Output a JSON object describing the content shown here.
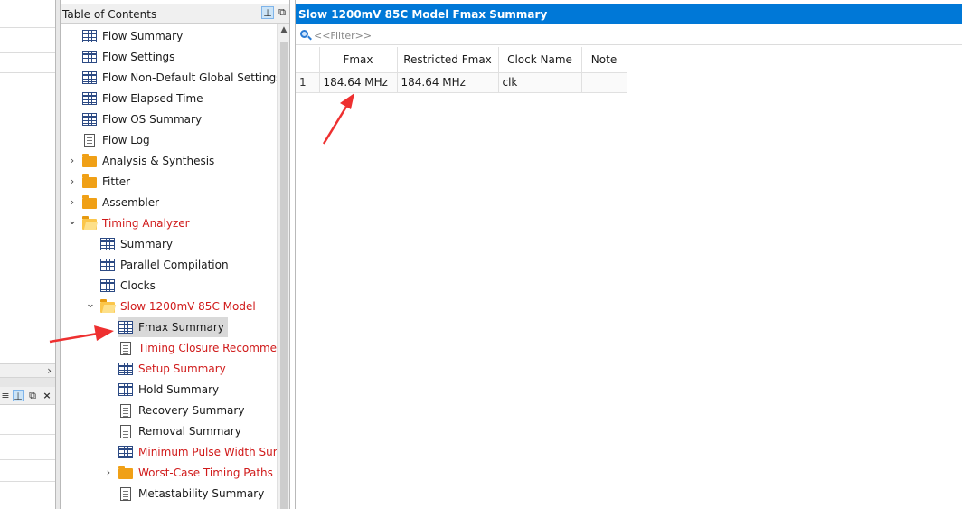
{
  "left_strip": {
    "scroll_right_icon": "chevron-right-icon",
    "panel_buttons": [
      "menu-icon",
      "pin-icon",
      "restore-icon",
      "close-icon"
    ],
    "panel_button_glyphs": [
      "≡",
      "⊥",
      "⧉",
      "×"
    ]
  },
  "toc": {
    "title": "Table of Contents",
    "header_buttons": [
      "pin-icon",
      "restore-icon"
    ],
    "header_button_glyphs": [
      "⊥",
      "⧉"
    ],
    "items": [
      {
        "label": "Flow Summary",
        "icon": "table-icon",
        "level": 0,
        "red": false
      },
      {
        "label": "Flow Settings",
        "icon": "table-icon",
        "level": 0,
        "red": false
      },
      {
        "label": "Flow Non-Default Global Settings",
        "icon": "table-icon",
        "level": 0,
        "red": false
      },
      {
        "label": "Flow Elapsed Time",
        "icon": "table-icon",
        "level": 0,
        "red": false
      },
      {
        "label": "Flow OS Summary",
        "icon": "table-icon",
        "level": 0,
        "red": false
      },
      {
        "label": "Flow Log",
        "icon": "document-icon",
        "level": 0,
        "red": false
      },
      {
        "label": "Analysis & Synthesis",
        "icon": "folder-icon",
        "level": 0,
        "red": false,
        "expander": "collapsed"
      },
      {
        "label": "Fitter",
        "icon": "folder-icon",
        "level": 0,
        "red": false,
        "expander": "collapsed"
      },
      {
        "label": "Assembler",
        "icon": "folder-icon",
        "level": 0,
        "red": false,
        "expander": "collapsed"
      },
      {
        "label": "Timing Analyzer",
        "icon": "folder-open-icon",
        "level": 0,
        "red": true,
        "expander": "expanded"
      },
      {
        "label": "Summary",
        "icon": "table-icon",
        "level": 1,
        "red": false
      },
      {
        "label": "Parallel Compilation",
        "icon": "table-icon",
        "level": 1,
        "red": false
      },
      {
        "label": "Clocks",
        "icon": "table-icon",
        "level": 1,
        "red": false
      },
      {
        "label": "Slow 1200mV 85C Model",
        "icon": "folder-open-icon",
        "level": 1,
        "red": true,
        "expander": "expanded"
      },
      {
        "label": "Fmax Summary",
        "icon": "table-icon",
        "level": 2,
        "red": false,
        "selected": true
      },
      {
        "label": "Timing Closure Recommendations",
        "icon": "document-icon",
        "level": 2,
        "red": true
      },
      {
        "label": "Setup Summary",
        "icon": "table-icon",
        "level": 2,
        "red": true
      },
      {
        "label": "Hold Summary",
        "icon": "table-icon",
        "level": 2,
        "red": false
      },
      {
        "label": "Recovery Summary",
        "icon": "document-icon",
        "level": 2,
        "red": false
      },
      {
        "label": "Removal Summary",
        "icon": "document-icon",
        "level": 2,
        "red": false
      },
      {
        "label": "Minimum Pulse Width Summary",
        "icon": "table-icon",
        "level": 2,
        "red": true
      },
      {
        "label": "Worst-Case Timing Paths",
        "icon": "folder-icon",
        "level": 2,
        "red": true,
        "expander": "collapsed"
      },
      {
        "label": "Metastability Summary",
        "icon": "document-icon",
        "level": 2,
        "red": false
      }
    ]
  },
  "main": {
    "title": "Slow 1200mV 85C Model Fmax Summary",
    "filter_placeholder": "<<Filter>>",
    "table": {
      "columns": [
        "",
        "Fmax",
        "Restricted Fmax",
        "Clock Name",
        "Note"
      ],
      "rows": [
        [
          "1",
          "184.64 MHz",
          "184.64 MHz",
          "clk",
          ""
        ]
      ]
    }
  },
  "colors": {
    "title_bar": "#0078d7",
    "red_text": "#d01a1a",
    "annotation_arrow": "#ee3030",
    "selected_row": "#d9d9d9"
  }
}
